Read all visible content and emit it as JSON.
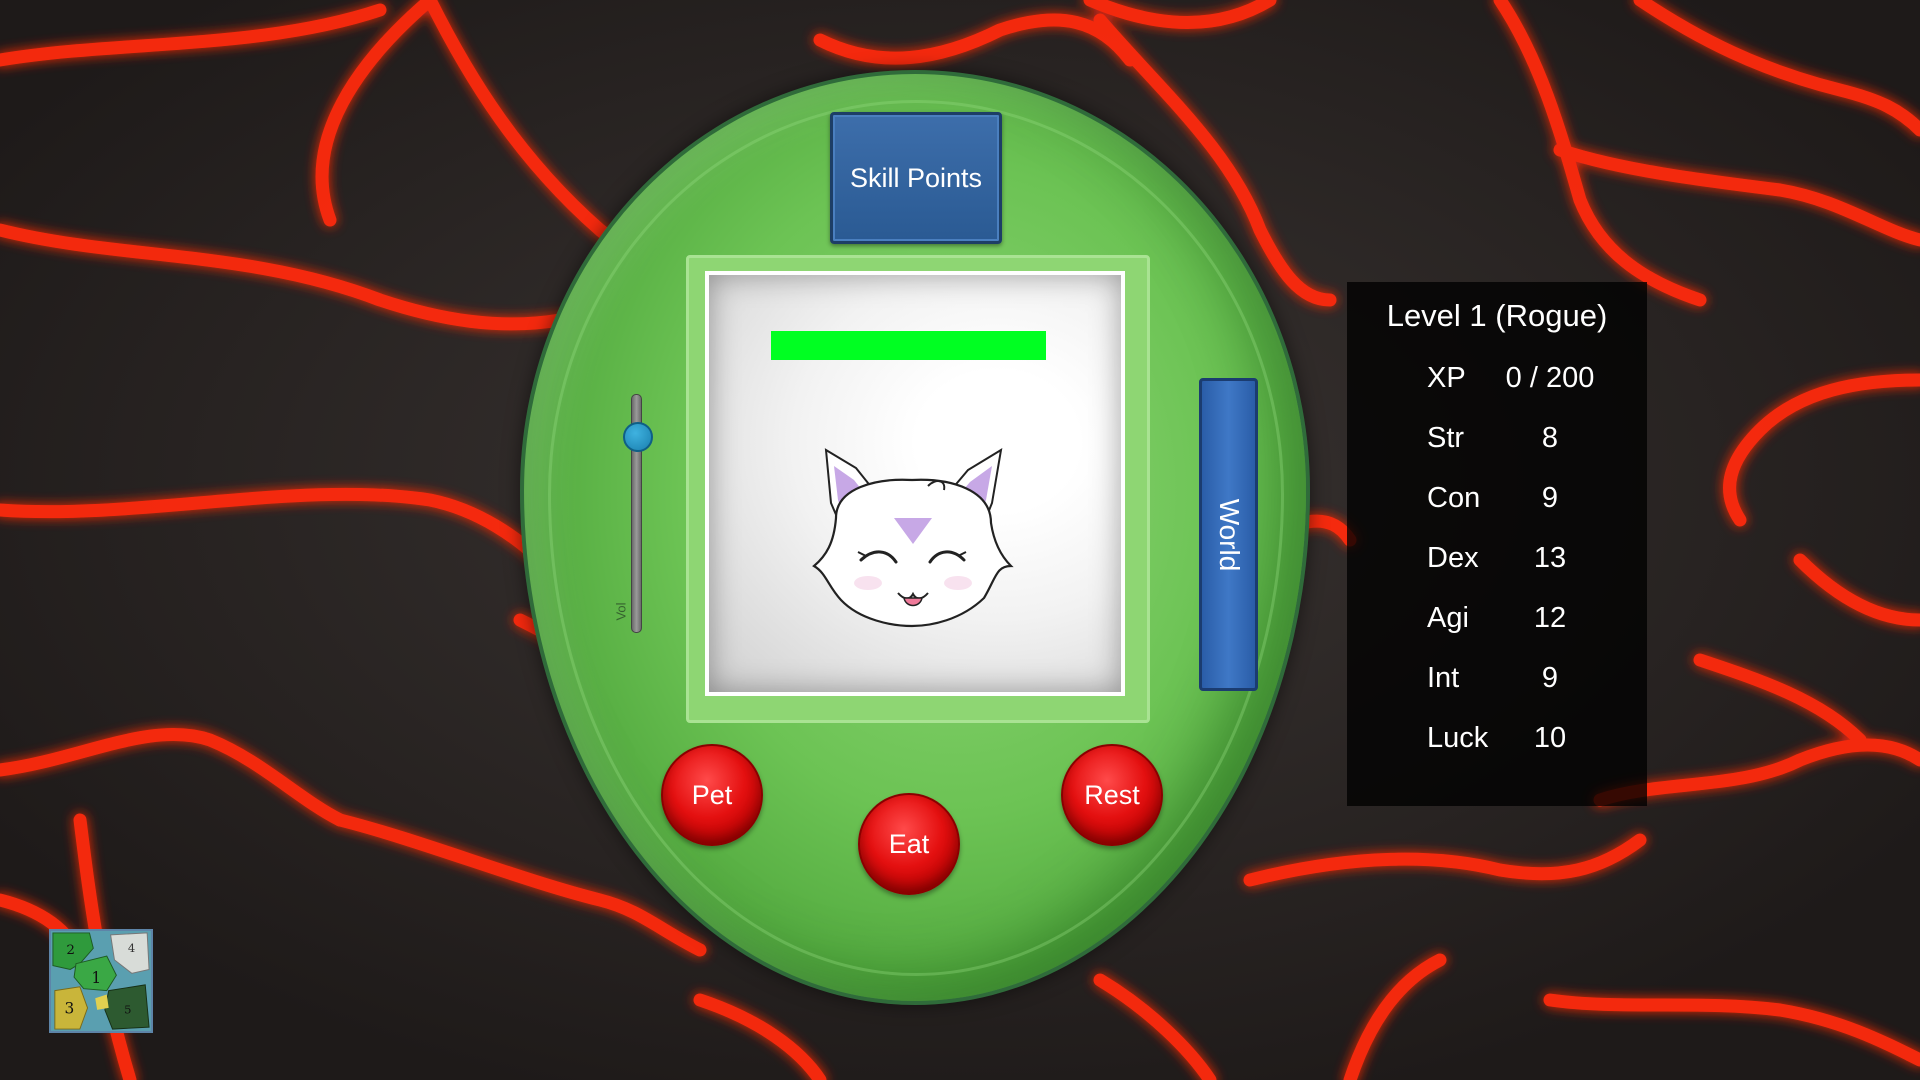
{
  "buttons": {
    "skill_points": "Skill Points",
    "world": "World",
    "pet": "Pet",
    "eat": "Eat",
    "rest": "Rest"
  },
  "volume": {
    "label": "Vol",
    "level": 0.82
  },
  "health": {
    "fill_fraction": 1.0,
    "color": "#00ff22"
  },
  "stats": {
    "title": "Level 1 (Rogue)",
    "rows": [
      {
        "name": "XP",
        "value": "0 / 200"
      },
      {
        "name": "Str",
        "value": "8"
      },
      {
        "name": "Con",
        "value": "9"
      },
      {
        "name": "Dex",
        "value": "13"
      },
      {
        "name": "Agi",
        "value": "12"
      },
      {
        "name": "Int",
        "value": "9"
      },
      {
        "name": "Luck",
        "value": "10"
      }
    ]
  },
  "minimap": {
    "regions": [
      "1",
      "2",
      "3",
      "4",
      "5"
    ]
  },
  "colors": {
    "lava": "#ff2a10",
    "device_green": "#6cc354",
    "button_red": "#e41010",
    "button_blue": "#2a5a93"
  }
}
